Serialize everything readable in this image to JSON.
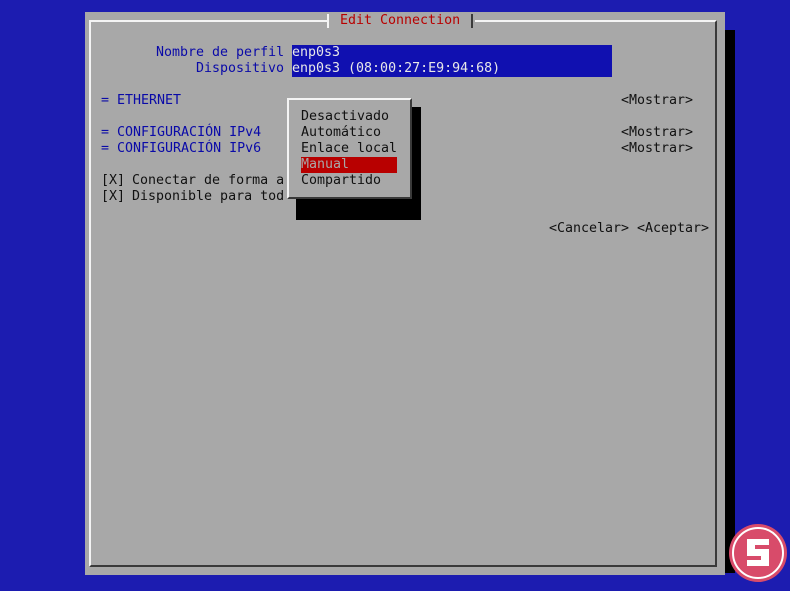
{
  "dialog": {
    "title": "Edit Connection"
  },
  "profile": {
    "name_label": "Nombre de perfil",
    "name_value": "enp0s3",
    "device_label": "Dispositivo",
    "device_value": "enp0s3 (08:00:27:E9:94:68)"
  },
  "sections": [
    {
      "label": "= ETHERNET",
      "action": "<Mostrar>"
    },
    {
      "label": "= CONFIGURACIÓN IPv4",
      "action": "<Mostrar>"
    },
    {
      "label": "= CONFIGURACIÓN IPv6",
      "action": "<Mostrar>"
    }
  ],
  "checkboxes": [
    {
      "state": "[X]",
      "label": "Conectar de forma a"
    },
    {
      "state": "[X]",
      "label": "Disponible para tod"
    }
  ],
  "buttons": {
    "cancel": "<Cancelar>",
    "accept": "<Aceptar>"
  },
  "dropdown": {
    "options": [
      "Desactivado",
      "Automático",
      "Enlace local",
      "Manual",
      "Compartido"
    ],
    "selected": "Manual"
  },
  "colors": {
    "background": "#1c1cb0",
    "dialog": "#a8a8a8",
    "accent_red": "#b80000",
    "label_blue": "#0a0aa8",
    "field_blue": "#1010b0"
  }
}
